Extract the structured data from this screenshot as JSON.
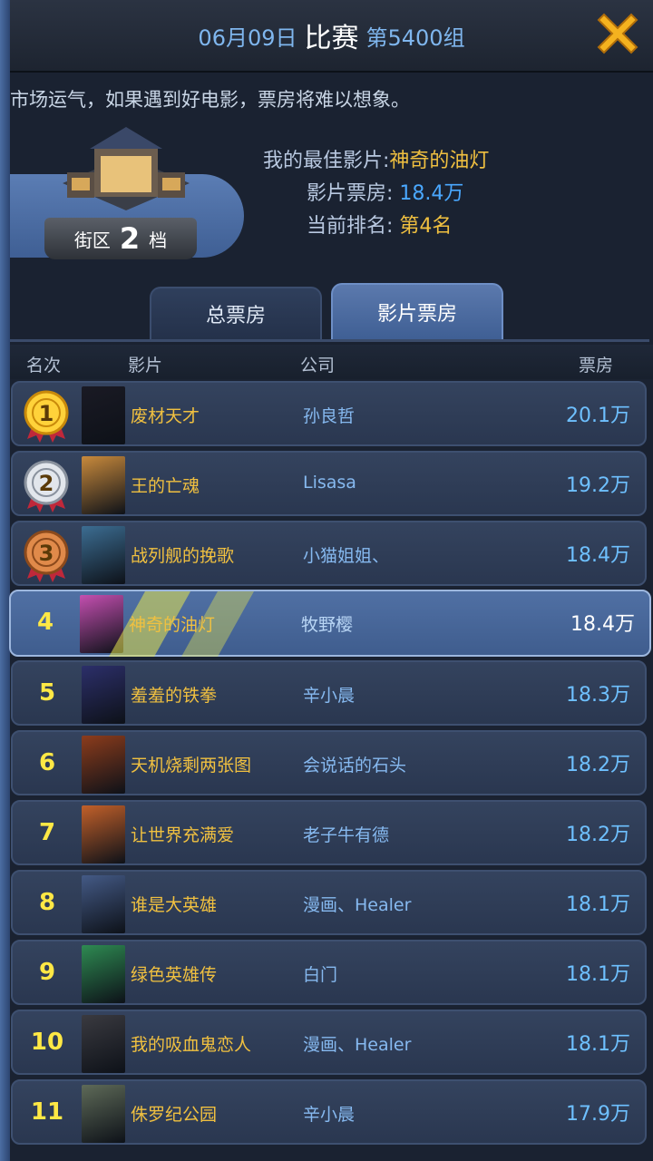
{
  "header": {
    "date": "06月09日",
    "title": "比赛",
    "group": "第5400组"
  },
  "marquee": "市场运气，如果遇到好电影，票房将难以想象。",
  "district": {
    "label_left": "街区",
    "level": "2",
    "label_right": "档"
  },
  "best": {
    "best_film_label": "我的最佳影片:",
    "best_film_value": "神奇的油灯",
    "box_label": "影片票房:",
    "box_value": "18.4万",
    "rank_label": "当前排名:",
    "rank_value": "第4名"
  },
  "tabs": {
    "total": "总票房",
    "film": "影片票房"
  },
  "columns": {
    "rank": "名次",
    "film": "影片",
    "company": "公司",
    "box": "票房"
  },
  "rows": [
    {
      "rank": "1",
      "film": "废材天才",
      "company": "孙良哲",
      "box": "20.1万",
      "poster": "#1a1a24"
    },
    {
      "rank": "2",
      "film": "王的亡魂",
      "company": "Lisasa",
      "box": "19.2万",
      "poster": "#c98a3c"
    },
    {
      "rank": "3",
      "film": "战列舰的挽歌",
      "company": "小猫姐姐、",
      "box": "18.4万",
      "poster": "#3c6d92"
    },
    {
      "rank": "4",
      "film": "神奇的油灯",
      "company": "牧野樱",
      "box": "18.4万",
      "poster": "#c44fb0"
    },
    {
      "rank": "5",
      "film": "羞羞的铁拳",
      "company": "辛小晨",
      "box": "18.3万",
      "poster": "#2c2f6a"
    },
    {
      "rank": "6",
      "film": "天机烧剩两张图",
      "company": "会说话的石头",
      "box": "18.2万",
      "poster": "#8c3c1c"
    },
    {
      "rank": "7",
      "film": "让世界充满爱",
      "company": "老子牛有德",
      "box": "18.2万",
      "poster": "#c2602a"
    },
    {
      "rank": "8",
      "film": "谁是大英雄",
      "company": "漫画、Healer",
      "box": "18.1万",
      "poster": "#445a86"
    },
    {
      "rank": "9",
      "film": "绿色英雄传",
      "company": "白门",
      "box": "18.1万",
      "poster": "#2e8a52"
    },
    {
      "rank": "10",
      "film": "我的吸血鬼恋人",
      "company": "漫画、Healer",
      "box": "18.1万",
      "poster": "#3a3a40"
    },
    {
      "rank": "11",
      "film": "侏罗纪公园",
      "company": "辛小晨",
      "box": "17.9万",
      "poster": "#5e6a58"
    }
  ],
  "colors": {
    "gold_text": "#f0c040",
    "blue_text": "#4aa8ff",
    "highlight_row": "#4a6aa0"
  }
}
